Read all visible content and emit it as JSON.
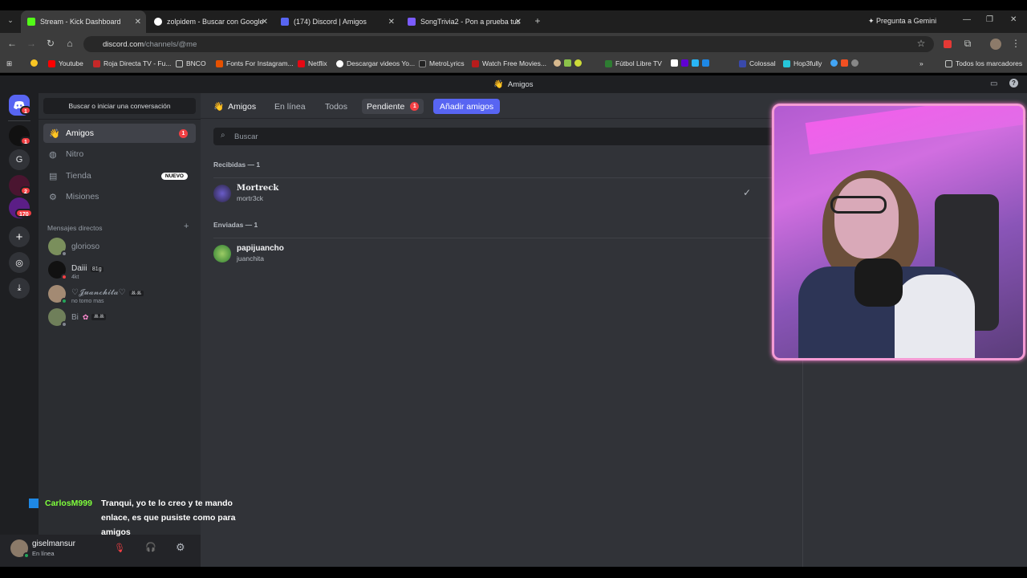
{
  "tabs": [
    {
      "label": "Stream - Kick Dashboard",
      "color": "#53fc18"
    },
    {
      "label": "zolpidem - Buscar con Google",
      "color": "#4285f4"
    },
    {
      "label": "(174) Discord | Amigos",
      "color": "#5865f2"
    },
    {
      "label": "SongTrivia2 - Pon a prueba tus",
      "color": "#7b5cff"
    }
  ],
  "gemini": "Pregunta a Gemini",
  "url": {
    "host": "discord.com",
    "path": "/channels/@me"
  },
  "bookmarks": [
    "Youtube",
    "Roja Directa TV - Fu...",
    "BNCO",
    "Fonts For Instagram...",
    "Netflix",
    "Descargar videos Yo...",
    "MetroLyrics",
    "Watch Free Movies...",
    "Fútbol Libre TV",
    "Colossal",
    "Hop3fully",
    "Todos los marcadores"
  ],
  "discord": {
    "window_title": "Amigos",
    "server_badges": [
      "1",
      "1",
      "2",
      "170"
    ],
    "server_letter": "G",
    "search_conversation": "Buscar o iniciar una conversación",
    "nav": [
      {
        "label": "Amigos",
        "badge": "1"
      },
      {
        "label": "Nitro"
      },
      {
        "label": "Tienda",
        "tag": "NUEVO"
      },
      {
        "label": "Misiones"
      }
    ],
    "dm_header": "Mensajes directos",
    "dms": [
      {
        "name": "glorioso",
        "sub": ""
      },
      {
        "name": "Daiii",
        "tag": "81g",
        "sub": "4kt"
      },
      {
        "name": "♡𝓙𝓾𝓪𝓷𝓬𝓱𝓲𝓽𝓪♡",
        "tag": "ꔛꔛ",
        "sub": "no tomo mas"
      },
      {
        "name": "Bi",
        "tag": "ꔛꔛ",
        "sub": ""
      }
    ],
    "user": {
      "name": "giselmansur",
      "status": "En línea"
    },
    "topnav": {
      "title": "Amigos",
      "online": "En línea",
      "all": "Todos",
      "pending": "Pendiente",
      "pending_badge": "1",
      "add": "Añadir amigos"
    },
    "search_placeholder": "Buscar",
    "received_header": "Recibidas — 1",
    "received": [
      {
        "name": "Mortreck",
        "user": "mortr3ck"
      }
    ],
    "sent_header": "Enviadas — 1",
    "sent": [
      {
        "name": "papijuancho",
        "user": "juanchita"
      }
    ]
  },
  "chat": {
    "user": "CarlosM999",
    "message": "Tranqui, yo te lo creo y te mando enlace, es que pusiste como para amigos"
  }
}
